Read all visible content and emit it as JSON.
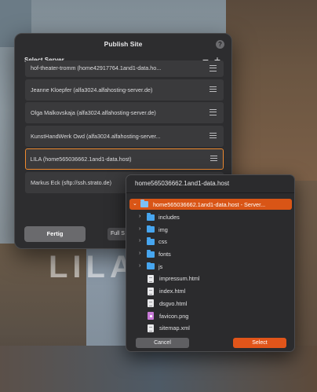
{
  "background": {
    "logo_text": "LILA"
  },
  "dialog": {
    "title": "Publish Site",
    "help_label": "?",
    "section_label": "Select Server",
    "remove_label": "−",
    "add_label": "+",
    "servers": [
      {
        "label": "hof-theater-tromm (home42917764.1and1-data.ho..."
      },
      {
        "label": "Jeanne Kloepfer (alfa3024.alfahosting-server.de)"
      },
      {
        "label": "Olga Malkovskaja (alfa3024.alfahosting-server.de)"
      },
      {
        "label": "KunstHandWerk Owd (alfa3024.alfahosting-server..."
      },
      {
        "label": "LILA (home565036662.1and1-data.host)",
        "selected": true
      },
      {
        "label": "Markus Eck (sftp://ssh.strato.de)"
      }
    ],
    "done_label": "Fertig",
    "full_label": "Full S"
  },
  "chooser": {
    "header": "home565036662.1and1-data.host",
    "root": {
      "label": "home565036662.1and1-data.host - Server...",
      "icon": "server-folder-icon"
    },
    "folders": [
      "includes",
      "img",
      "css",
      "fonts",
      "js"
    ],
    "files": [
      {
        "name": "impressum.html",
        "icon": "document-icon"
      },
      {
        "name": "index.html",
        "icon": "document-icon"
      },
      {
        "name": "dsgvo.html",
        "icon": "document-icon"
      },
      {
        "name": "favicon.png",
        "icon": "image-icon"
      },
      {
        "name": "sitemap.xml",
        "icon": "document-icon"
      }
    ],
    "cancel_label": "Cancel",
    "select_label": "Select"
  },
  "colors": {
    "accent": "#ef8a2f",
    "select_button": "#e1551a",
    "folder": "#47a6f0"
  }
}
